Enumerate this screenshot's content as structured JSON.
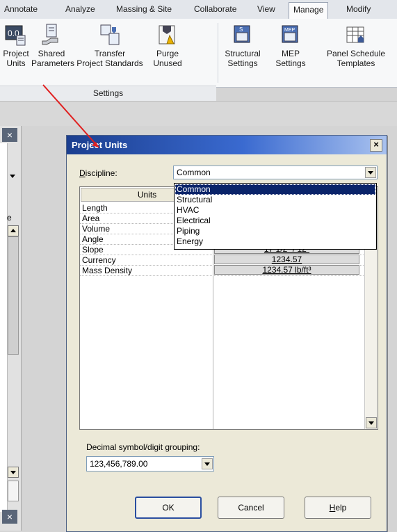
{
  "ribbon_tabs": [
    "Annotate",
    "Analyze",
    "Massing & Site",
    "Collaborate",
    "View",
    "Manage",
    "Modify"
  ],
  "active_tab": "Manage",
  "ribbon_buttons": [
    {
      "id": "project-units",
      "label": "Project\nUnits",
      "icon": "project-units-icon"
    },
    {
      "id": "shared-parameters",
      "label": "Shared\nParameters",
      "icon": "shared-parameters-icon"
    },
    {
      "id": "transfer-project-standards",
      "label": "Transfer\nProject Standards",
      "icon": "transfer-standards-icon"
    },
    {
      "id": "purge-unused",
      "label": "Purge\nUnused",
      "icon": "purge-unused-icon"
    },
    {
      "id": "structural-settings",
      "label": "Structural\nSettings",
      "icon": "structural-settings-icon"
    },
    {
      "id": "mep-settings",
      "label": "MEP\nSettings",
      "icon": "mep-settings-icon"
    },
    {
      "id": "panel-schedule-templates",
      "label": "Panel Schedule\nTemplates",
      "icon": "panel-schedule-icon"
    }
  ],
  "settings_panel_label": "Settings",
  "dialog": {
    "title": "Project Units",
    "close_glyph": "×",
    "discipline_label": "Discipline:",
    "discipline_value": "Common",
    "discipline_options": [
      "Common",
      "Structural",
      "HVAC",
      "Electrical",
      "Piping",
      "Energy"
    ],
    "discipline_selected_index": 0,
    "table_header_units": "Units",
    "rows": [
      {
        "name": "Length",
        "format": ""
      },
      {
        "name": "Area",
        "format": ""
      },
      {
        "name": "Volume",
        "format": ""
      },
      {
        "name": "Angle",
        "format": ""
      },
      {
        "name": "Slope",
        "format": "17 1/2\" / 12\""
      },
      {
        "name": "Currency",
        "format": "1234.57"
      },
      {
        "name": "Mass Density",
        "format": "1234.57 lb/ft³"
      }
    ],
    "decimal_label": "Decimal symbol/digit grouping:",
    "decimal_value": "123,456,789.00",
    "ok_label": "OK",
    "cancel_label": "Cancel",
    "help_label": "Help"
  },
  "left_panel": {
    "close_glyph": "×",
    "letter": "e"
  },
  "colors": {
    "title_bar_start": "#1b3e8f",
    "selection": "#0a246a",
    "annotation_arrow": "#e02020"
  }
}
